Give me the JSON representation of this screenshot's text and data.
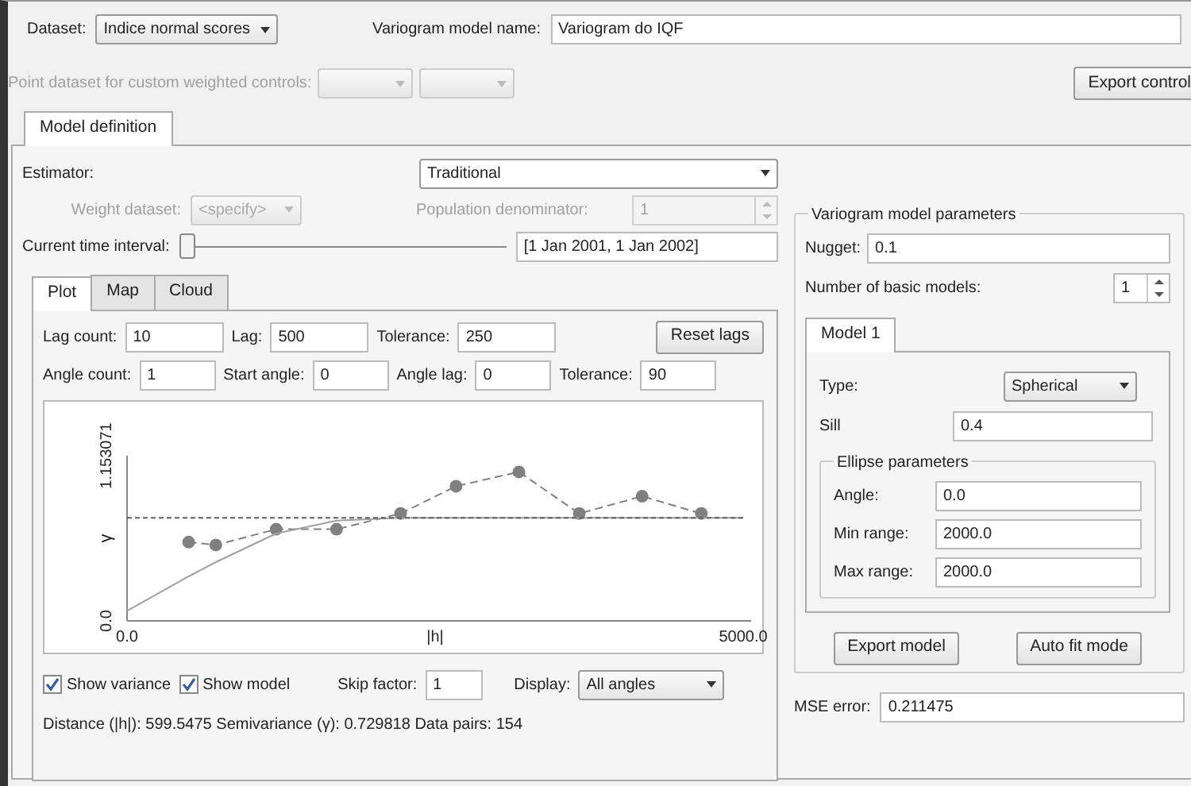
{
  "toolbar": {
    "dataset_label": "Dataset:",
    "dataset": "Indice normal scores",
    "model_name_label": "Variogram model name:",
    "model_name": "Variogram do IQF"
  },
  "point_dataset": {
    "label": "Point dataset for custom weighted controls:",
    "disabled": true,
    "export_button": "Export control"
  },
  "main_tabs": [
    {
      "label": "Model definition",
      "selected": true
    }
  ],
  "estimator": {
    "label": "Estimator:",
    "value": "Traditional"
  },
  "weight_dataset": {
    "label": "Weight dataset:",
    "value": "<specify>",
    "disabled": true
  },
  "population_denominator": {
    "label": "Population denominator:",
    "value": "1",
    "disabled": true
  },
  "time_interval": {
    "label": "Current time interval:",
    "level": 0,
    "value": "[1 Jan 2001, 1 Jan 2002]"
  },
  "plot_tabs": [
    {
      "label": "Plot",
      "selected": true
    },
    {
      "label": "Map",
      "selected": false
    },
    {
      "label": "Cloud",
      "selected": false
    }
  ],
  "lag_fields": [
    {
      "label": "Lag count:",
      "value": "10"
    },
    {
      "label": "Lag:",
      "value": "500"
    },
    {
      "label": "Tolerance:",
      "value": "250"
    }
  ],
  "reset_button": "Reset lags",
  "angle_fields": [
    {
      "label": "Angle count:",
      "value": "1"
    },
    {
      "label": "Start angle:",
      "value": "0"
    },
    {
      "label": "Angle lag:",
      "value": "0"
    },
    {
      "label": "Tolerance:",
      "value": "90"
    }
  ],
  "chart": {
    "chart_data": {
      "type": "line",
      "xlabel": "|h|",
      "ylabel": "γ",
      "x": [
        0,
        500,
        720,
        1210,
        1700,
        2220,
        2670,
        3180,
        3670,
        4180,
        4660,
        5000
      ],
      "series": [
        {
          "color": "#808080",
          "line_style": "dashed",
          "marker": "circle",
          "values": [
            null,
            0.55,
            0.53,
            0.64,
            0.64,
            0.75,
            0.94,
            1.04,
            0.75,
            0.87,
            0.75,
            null
          ]
        },
        {
          "color": "#a0a0a0",
          "line_style": "solid",
          "values": [
            0.07,
            0.31,
            0.41,
            0.61,
            0.7,
            0.72,
            0.72,
            0.72,
            0.72,
            0.72,
            0.72,
            0.72
          ]
        },
        {
          "color": "#606060",
          "line_style": "dashed",
          "values": [
            0.72,
            0.72,
            0.72,
            0.72,
            0.72,
            0.72,
            0.72,
            0.72,
            0.72,
            0.72,
            0.72,
            0.72
          ]
        }
      ],
      "xlim": [
        0,
        5000
      ],
      "ylim": [
        0,
        1.153071
      ],
      "xticks": [
        {
          "value": 0,
          "label": "0.0"
        },
        {
          "value": 5000,
          "label": "5000.0"
        }
      ],
      "yticks": [
        {
          "value": 0,
          "label": "0.0"
        },
        {
          "value": 1.153071,
          "label": "1.153071"
        }
      ]
    }
  },
  "show_variance": {
    "label": "Show variance",
    "checked": true
  },
  "show_model": {
    "label": "Show model",
    "checked": true
  },
  "skip_factor": {
    "label": "Skip factor:",
    "value": "1"
  },
  "display": {
    "label": "Display:",
    "value": "All angles"
  },
  "status": "Distance (|h|): 599.5475  Semivariance (γ): 0.729818  Data pairs: 154",
  "model_parameters": {
    "title": "Variogram model parameters",
    "nugget_label": "Nugget:",
    "nugget": "0.1",
    "count_label": "Number of basic models:",
    "count": "1",
    "model_tabs": [
      {
        "label": "Model 1",
        "selected": true
      }
    ],
    "type_label": "Type:",
    "type": "Spherical",
    "sill_label": "Sill",
    "sill": "0.4",
    "ellipse": {
      "title": "Ellipse parameters",
      "fields": [
        {
          "label": "Angle:",
          "value": "0.0"
        },
        {
          "label": "Min range:",
          "value": "2000.0"
        },
        {
          "label": "Max range:",
          "value": "2000.0"
        }
      ]
    },
    "buttons": [
      "Export model",
      "Auto fit mode"
    ]
  },
  "mse": {
    "label": "MSE error:",
    "value": "0.211475"
  }
}
